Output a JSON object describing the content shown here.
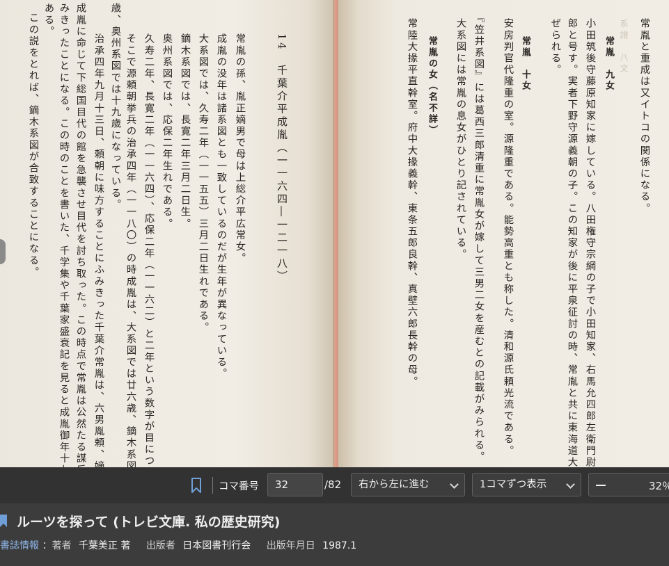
{
  "book": {
    "right_page": {
      "header_faint": "系譜　八文",
      "columns": [
        {
          "text": "常胤と重成は又イトコの関係になる。",
          "style": ""
        },
        {
          "text": "常胤　九女",
          "style": "bold"
        },
        {
          "text": "小田筑後守藤原知家に嫁している。八田権守宗綱の子で小田知家、右馬允四郎左衛門尉八田四",
          "style": ""
        },
        {
          "text": "郎と号す。実者下野守源義朝の子。この知家が後に平泉征討の時、常胤と共に東海道大将軍に任",
          "style": ""
        },
        {
          "text": "ぜられる。",
          "style": ""
        },
        {
          "text": "常胤　十女",
          "style": "bold"
        },
        {
          "text": "安房判官代隆重の室。源隆重である。能勢高重とも称した。清和源氏頼光流である。",
          "style": ""
        },
        {
          "text": "『笠井系図』には葛西三郎清重に常胤女が嫁して三男二女を産むとの記載がみられる。",
          "style": ""
        },
        {
          "text": "大系図には常胤の息女がひとり記されている。",
          "style": ""
        },
        {
          "text": "常胤の女（名不詳）",
          "style": "bold"
        },
        {
          "text": "常陸大掾平直幹室。府中大掾義幹、東条五郎良幹、真壁六郎長幹の母。",
          "style": ""
        }
      ]
    },
    "left_page": {
      "columns": [
        {
          "text": "14　千葉介平成胤（一一六四―一二一八）",
          "style": "heading"
        },
        {
          "text": "常胤の孫、胤正嫡男で母は上総介平広常女。",
          "style": ""
        },
        {
          "text": "成胤の没年は諸系図とも一致しているのだが生年が異なっている。",
          "style": ""
        },
        {
          "text": "大系図では、久寿二年（一一五五）三月二日生れである。",
          "style": ""
        },
        {
          "text": "鏑木系図では、長寛二年三月二日生。",
          "style": ""
        },
        {
          "text": "奥州系図では、応保二年生れである。",
          "style": ""
        },
        {
          "text": "久寿二年、長寛二年（一一六四）、応保二年（一一六二）と二年という数字が目についてくる。",
          "style": ""
        },
        {
          "text": "そこで源頼朝挙兵の治承四年（一一八〇）の時成胤は、大系図では廿六歳、鏑木系図では十七",
          "style": ""
        },
        {
          "text": "歳、奥州系図では十九歳になっている。",
          "style": ""
        },
        {
          "text": "治承四年九月十三日、頼朝に味方することにふみきった千葉介常胤は、六男胤頼、嫡孫小太郎",
          "style": ""
        },
        {
          "text": "成胤に命じて下総国目代の館を急襲させ目代を討ち取った。この時点で常胤は公然たる謀反にふ",
          "style": ""
        },
        {
          "text": "みきったことになる。この時のことを書いた、千学集や千葉家盛衰記を見ると成胤御年十七歳と",
          "style": ""
        },
        {
          "text": "ある。",
          "style": ""
        },
        {
          "text": "この説をとれば、鏑木系図が合致することになる。",
          "style": ""
        }
      ]
    }
  },
  "toolbar": {
    "bookmark_icon": "bookmark-icon",
    "frame_label": "コマ番号",
    "frame_value": "32",
    "frame_total": "/82",
    "direction": "右から左に進む",
    "display": "1コマずつ表示",
    "zoom": "32％"
  },
  "info": {
    "title": "ルーツを探って (トレビ文庫. 私の歴史研究)",
    "biblio_link": "書誌情報",
    "author_label": "：著者",
    "author": "千葉美正 著",
    "publisher_label": "出版者",
    "publisher": "日本図書刊行会",
    "date_label": "出版年月日",
    "date": "1987.1"
  }
}
